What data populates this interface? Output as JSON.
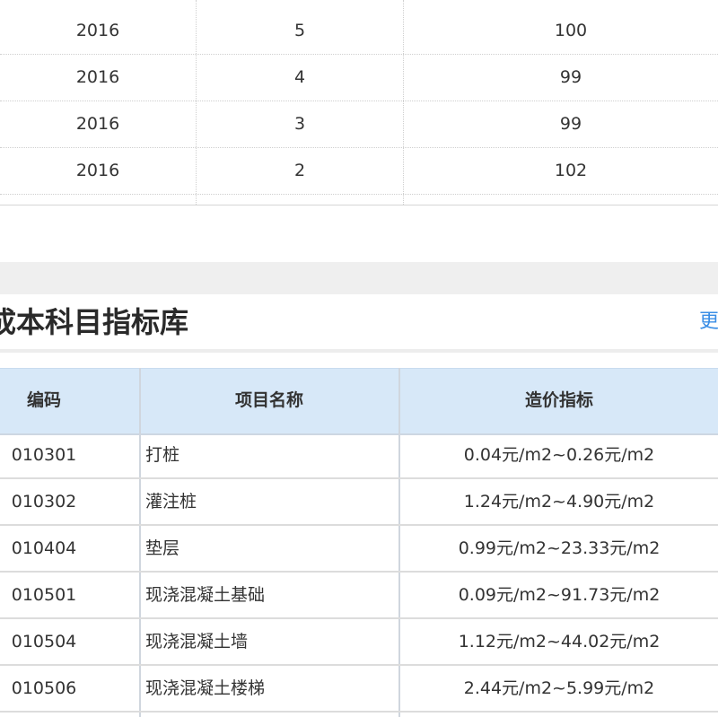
{
  "price_table": {
    "rows": [
      {
        "year": "2016",
        "month": "5",
        "value": "100"
      },
      {
        "year": "2016",
        "month": "4",
        "value": "99"
      },
      {
        "year": "2016",
        "month": "3",
        "value": "99"
      },
      {
        "year": "2016",
        "month": "2",
        "value": "102"
      }
    ]
  },
  "index_section": {
    "title": "成本科目指标库",
    "more_label": "更",
    "headers": {
      "code": "编码",
      "name": "项目名称",
      "price": "造价指标"
    },
    "rows": [
      {
        "code": "010301",
        "name": "打桩",
        "price": "0.04元/m2~0.26元/m2"
      },
      {
        "code": "010302",
        "name": "灌注桩",
        "price": "1.24元/m2~4.90元/m2"
      },
      {
        "code": "010404",
        "name": "垫层",
        "price": "0.99元/m2~23.33元/m2"
      },
      {
        "code": "010501",
        "name": "现浇混凝土基础",
        "price": "0.09元/m2~91.73元/m2"
      },
      {
        "code": "010504",
        "name": "现浇混凝土墙",
        "price": "1.12元/m2~44.02元/m2"
      },
      {
        "code": "010506",
        "name": "现浇混凝土楼梯",
        "price": "2.44元/m2~5.99元/m2"
      }
    ]
  }
}
